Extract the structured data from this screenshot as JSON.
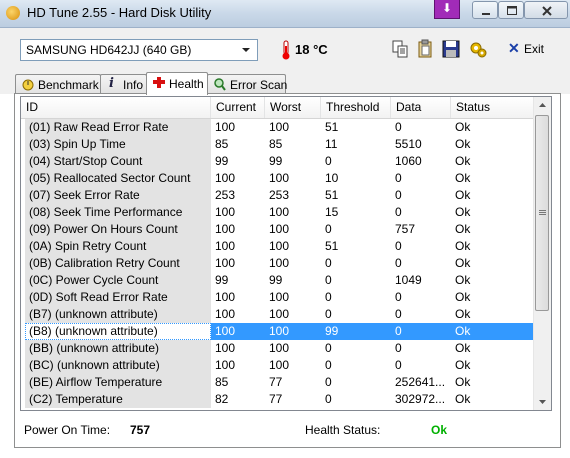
{
  "window": {
    "title": "HD Tune 2.55 - Hard Disk Utility"
  },
  "toolbar": {
    "drive": "SAMSUNG HD642JJ (640 GB)",
    "temperature": "18 °C",
    "exit_label": "Exit"
  },
  "tabs": [
    {
      "label": "Benchmark",
      "icon": "stopwatch-icon"
    },
    {
      "label": "Info",
      "icon": "info-icon"
    },
    {
      "label": "Health",
      "icon": "red-cross-icon"
    },
    {
      "label": "Error Scan",
      "icon": "magnifier-icon"
    }
  ],
  "active_tab": "Health",
  "table": {
    "columns": [
      "ID",
      "Current",
      "Worst",
      "Threshold",
      "Data",
      "Status"
    ],
    "rows": [
      [
        "(01) Raw Read Error Rate",
        "100",
        "100",
        "51",
        "0",
        "Ok"
      ],
      [
        "(03) Spin Up Time",
        "85",
        "85",
        "11",
        "5510",
        "Ok"
      ],
      [
        "(04) Start/Stop Count",
        "99",
        "99",
        "0",
        "1060",
        "Ok"
      ],
      [
        "(05) Reallocated Sector Count",
        "100",
        "100",
        "10",
        "0",
        "Ok"
      ],
      [
        "(07) Seek Error Rate",
        "253",
        "253",
        "51",
        "0",
        "Ok"
      ],
      [
        "(08) Seek Time Performance",
        "100",
        "100",
        "15",
        "0",
        "Ok"
      ],
      [
        "(09) Power On Hours Count",
        "100",
        "100",
        "0",
        "757",
        "Ok"
      ],
      [
        "(0A) Spin Retry Count",
        "100",
        "100",
        "51",
        "0",
        "Ok"
      ],
      [
        "(0B) Calibration Retry Count",
        "100",
        "100",
        "0",
        "0",
        "Ok"
      ],
      [
        "(0C) Power Cycle Count",
        "99",
        "99",
        "0",
        "1049",
        "Ok"
      ],
      [
        "(0D) Soft Read Error Rate",
        "100",
        "100",
        "0",
        "0",
        "Ok"
      ],
      [
        "(B7) (unknown attribute)",
        "100",
        "100",
        "0",
        "0",
        "Ok"
      ],
      [
        "(B8) (unknown attribute)",
        "100",
        "100",
        "99",
        "0",
        "Ok"
      ],
      [
        "(BB) (unknown attribute)",
        "100",
        "100",
        "0",
        "0",
        "Ok"
      ],
      [
        "(BC) (unknown attribute)",
        "100",
        "100",
        "0",
        "0",
        "Ok"
      ],
      [
        "(BE) Airflow Temperature",
        "85",
        "77",
        "0",
        "252641...",
        "Ok"
      ],
      [
        "(C2) Temperature",
        "82",
        "77",
        "0",
        "302972...",
        "Ok"
      ]
    ],
    "selected_row": 12
  },
  "footer": {
    "power_on_label": "Power On Time:",
    "power_on_value": "757",
    "health_label": "Health Status:",
    "health_value": "Ok",
    "health_color": "#00b000"
  }
}
